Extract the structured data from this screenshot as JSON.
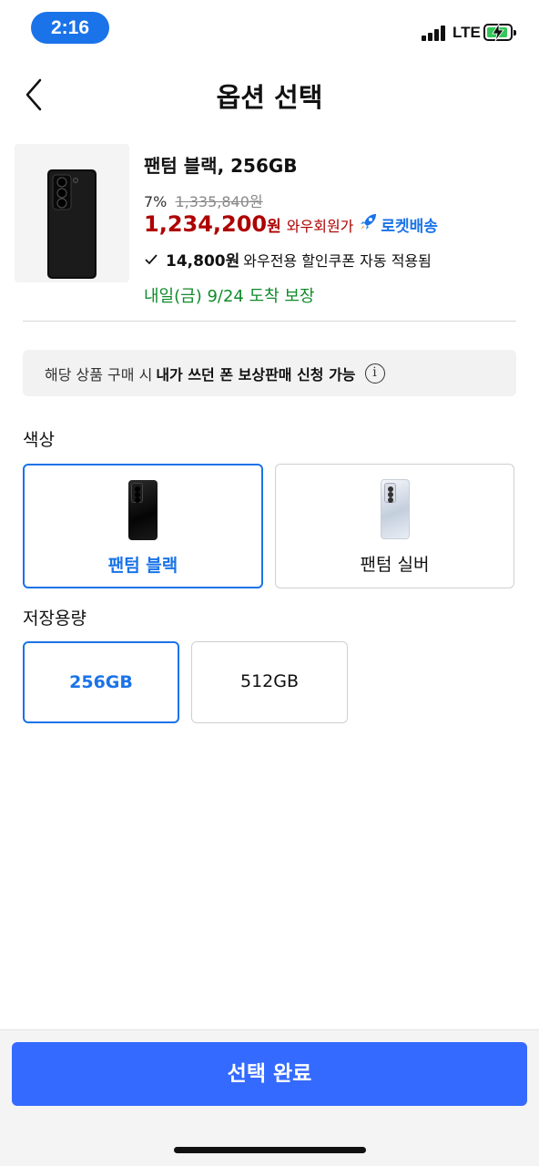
{
  "status_bar": {
    "time": "2:16",
    "network": "LTE",
    "battery_icon": "battery-charging-icon"
  },
  "header": {
    "title": "옵션 선택",
    "back_icon": "chevron-left-icon"
  },
  "product": {
    "name": "팬텀 블랙, 256GB",
    "discount_rate": "7%",
    "original_price": "1,335,840원",
    "price": "1,234,200",
    "price_unit": "원",
    "member_label": "와우회원가",
    "delivery_badge": "로켓배송",
    "coupon_amount": "14,800원",
    "coupon_text": "와우전용 할인쿠폰 자동 적용됨",
    "delivery_eta": "내일(금) 9/24 도착 보장"
  },
  "notice": {
    "text_prefix": "해당 상품 구매 시",
    "text_bold": "내가 쓰던 폰 보상판매 신청 가능",
    "icon": "info-icon"
  },
  "color_section": {
    "title": "색상",
    "options": [
      {
        "label": "팬텀 블랙",
        "selected": true
      },
      {
        "label": "팬텀 실버",
        "selected": false
      }
    ]
  },
  "storage_section": {
    "title": "저장용량",
    "options": [
      {
        "label": "256GB",
        "selected": true
      },
      {
        "label": "512GB",
        "selected": false
      }
    ]
  },
  "footer": {
    "confirm_label": "선택 완료"
  },
  "colors": {
    "accent": "#1a73e8",
    "confirm_button": "#346aff",
    "price": "#ae0000",
    "delivery": "#108b2b",
    "selected_border": "#1a73e8"
  }
}
